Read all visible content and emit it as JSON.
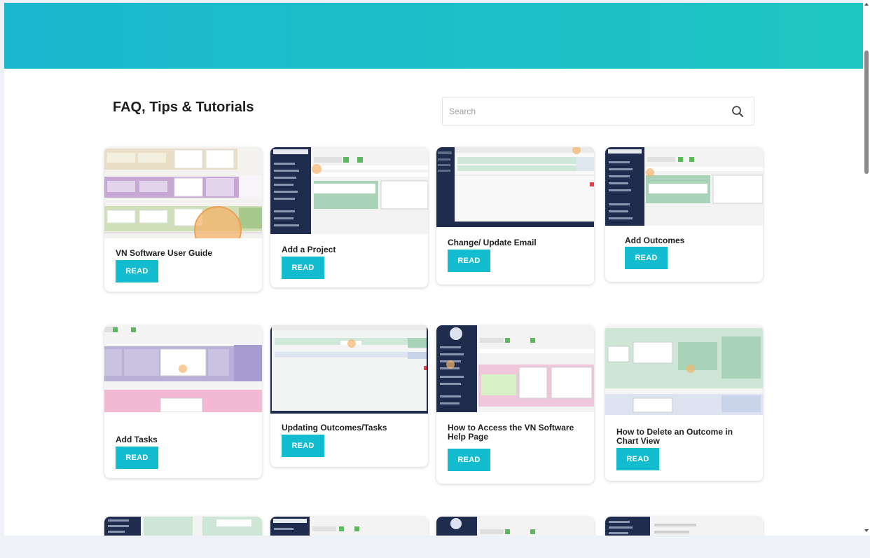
{
  "page": {
    "title": "FAQ, Tips & Tutorials",
    "accent_color": "#14bcd0",
    "banner_colors": [
      "#1ab8cf",
      "#1ec6c2"
    ]
  },
  "search": {
    "placeholder": "Search",
    "value": "",
    "icon": "search-icon"
  },
  "articles": [
    {
      "title": "VN Software User Guide",
      "button": "READ"
    },
    {
      "title": "Add a Project",
      "button": "READ"
    },
    {
      "title": "Change/ Update Email",
      "button": "READ"
    },
    {
      "title": "Add Outcomes",
      "button": "READ"
    },
    {
      "title": "Add Tasks",
      "button": "READ"
    },
    {
      "title": "Updating Outcomes/Tasks",
      "button": "READ"
    },
    {
      "title": "How to Access the VN Software Help Page",
      "button": "READ"
    },
    {
      "title": "How to Delete an Outcome in Chart View",
      "button": "READ"
    },
    {
      "title": "",
      "button": ""
    },
    {
      "title": "",
      "button": ""
    },
    {
      "title": "",
      "button": ""
    },
    {
      "title": "",
      "button": ""
    }
  ]
}
